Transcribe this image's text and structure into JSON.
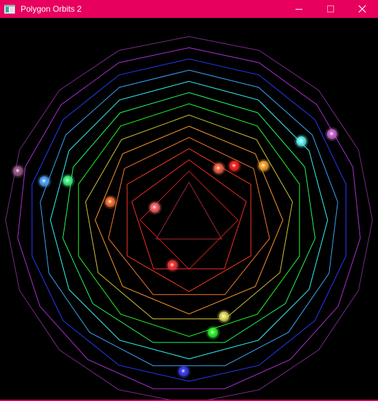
{
  "window": {
    "title": "Polygon Orbits 2",
    "titlebar_color": "#e8005f",
    "background": "#000000"
  },
  "controls": {
    "minimize_icon": "minimize-icon",
    "maximize_icon": "maximize-icon",
    "close_icon": "close-icon"
  },
  "orbits": [
    {
      "sides": 3,
      "color": "#a1283a",
      "ball_color": "#ff6b6b"
    },
    {
      "sides": 4,
      "color": "#c81e1e",
      "ball_color": "#ff3b3b"
    },
    {
      "sides": 5,
      "color": "#ff2a2a",
      "ball_color": "#ff6a4a"
    },
    {
      "sides": 6,
      "color": "#ff3a1e",
      "ball_color": "#ff2a2a"
    },
    {
      "sides": 7,
      "color": "#ff7a30",
      "ball_color": "#ff7a3a"
    },
    {
      "sides": 8,
      "color": "#ff9a2a",
      "ball_color": "#ffaa33"
    },
    {
      "sides": 9,
      "color": "#d8c838",
      "ball_color": "#e8e060"
    },
    {
      "sides": 10,
      "color": "#22ff22",
      "ball_color": "#33ff33"
    },
    {
      "sides": 11,
      "color": "#22ff66",
      "ball_color": "#44ff88"
    },
    {
      "sides": 12,
      "color": "#33ffff",
      "ball_color": "#66ffff"
    },
    {
      "sides": 13,
      "color": "#3aa8ff",
      "ball_color": "#55aaff"
    },
    {
      "sides": 14,
      "color": "#2a3aff",
      "ball_color": "#4444ff"
    },
    {
      "sides": 15,
      "color": "#b030d8",
      "ball_color": "#d070d8"
    },
    {
      "sides": 16,
      "color": "#7a2a8a",
      "ball_color": "#a06090"
    }
  ]
}
